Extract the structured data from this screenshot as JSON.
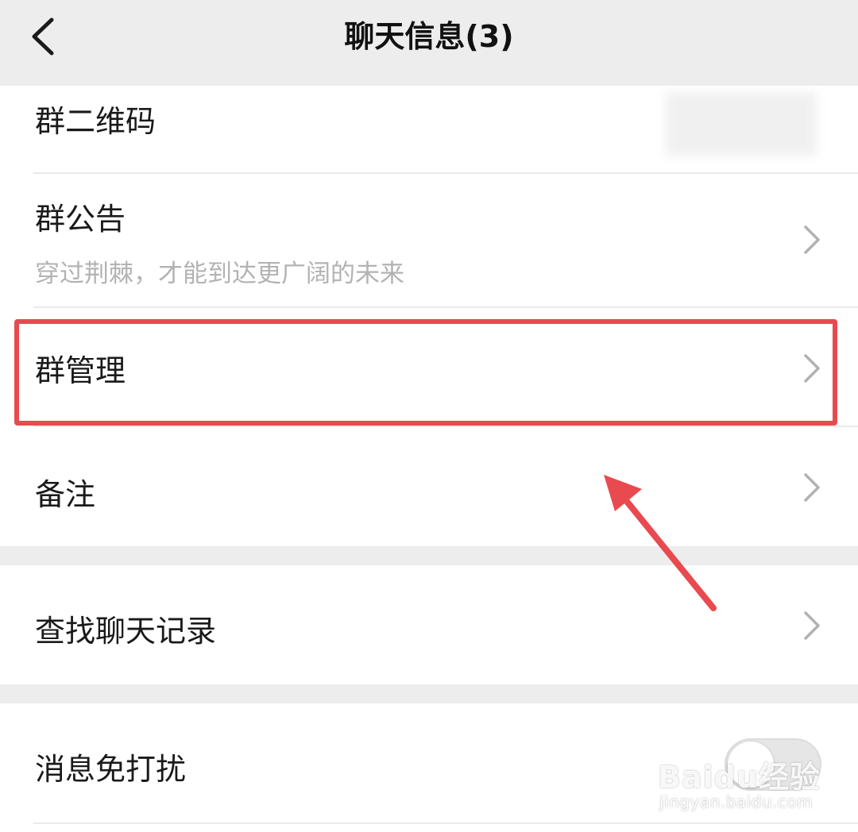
{
  "header": {
    "title": "聊天信息(3)",
    "back_icon": "chevron-left-icon"
  },
  "rows": {
    "qr_code": {
      "label": "群二维码"
    },
    "announcement": {
      "label": "群公告",
      "subtitle": "穿过荆棘，才能到达更广阔的未来"
    },
    "group_manage": {
      "label": "群管理"
    },
    "remark": {
      "label": "备注"
    },
    "search_history": {
      "label": "查找聊天记录"
    },
    "mute": {
      "label": "消息免打扰",
      "toggle_on": false
    }
  },
  "annotation": {
    "highlight_color": "#e84a4f",
    "highlight_target": "群管理"
  },
  "watermark": {
    "logo": "Baidu经验",
    "url": "jingyan.baidu.com"
  },
  "colors": {
    "background": "#ededed",
    "surface": "#ffffff",
    "text_primary": "#1a1a1a",
    "text_secondary": "#b3b3b3",
    "chevron": "#b2b2b2"
  }
}
